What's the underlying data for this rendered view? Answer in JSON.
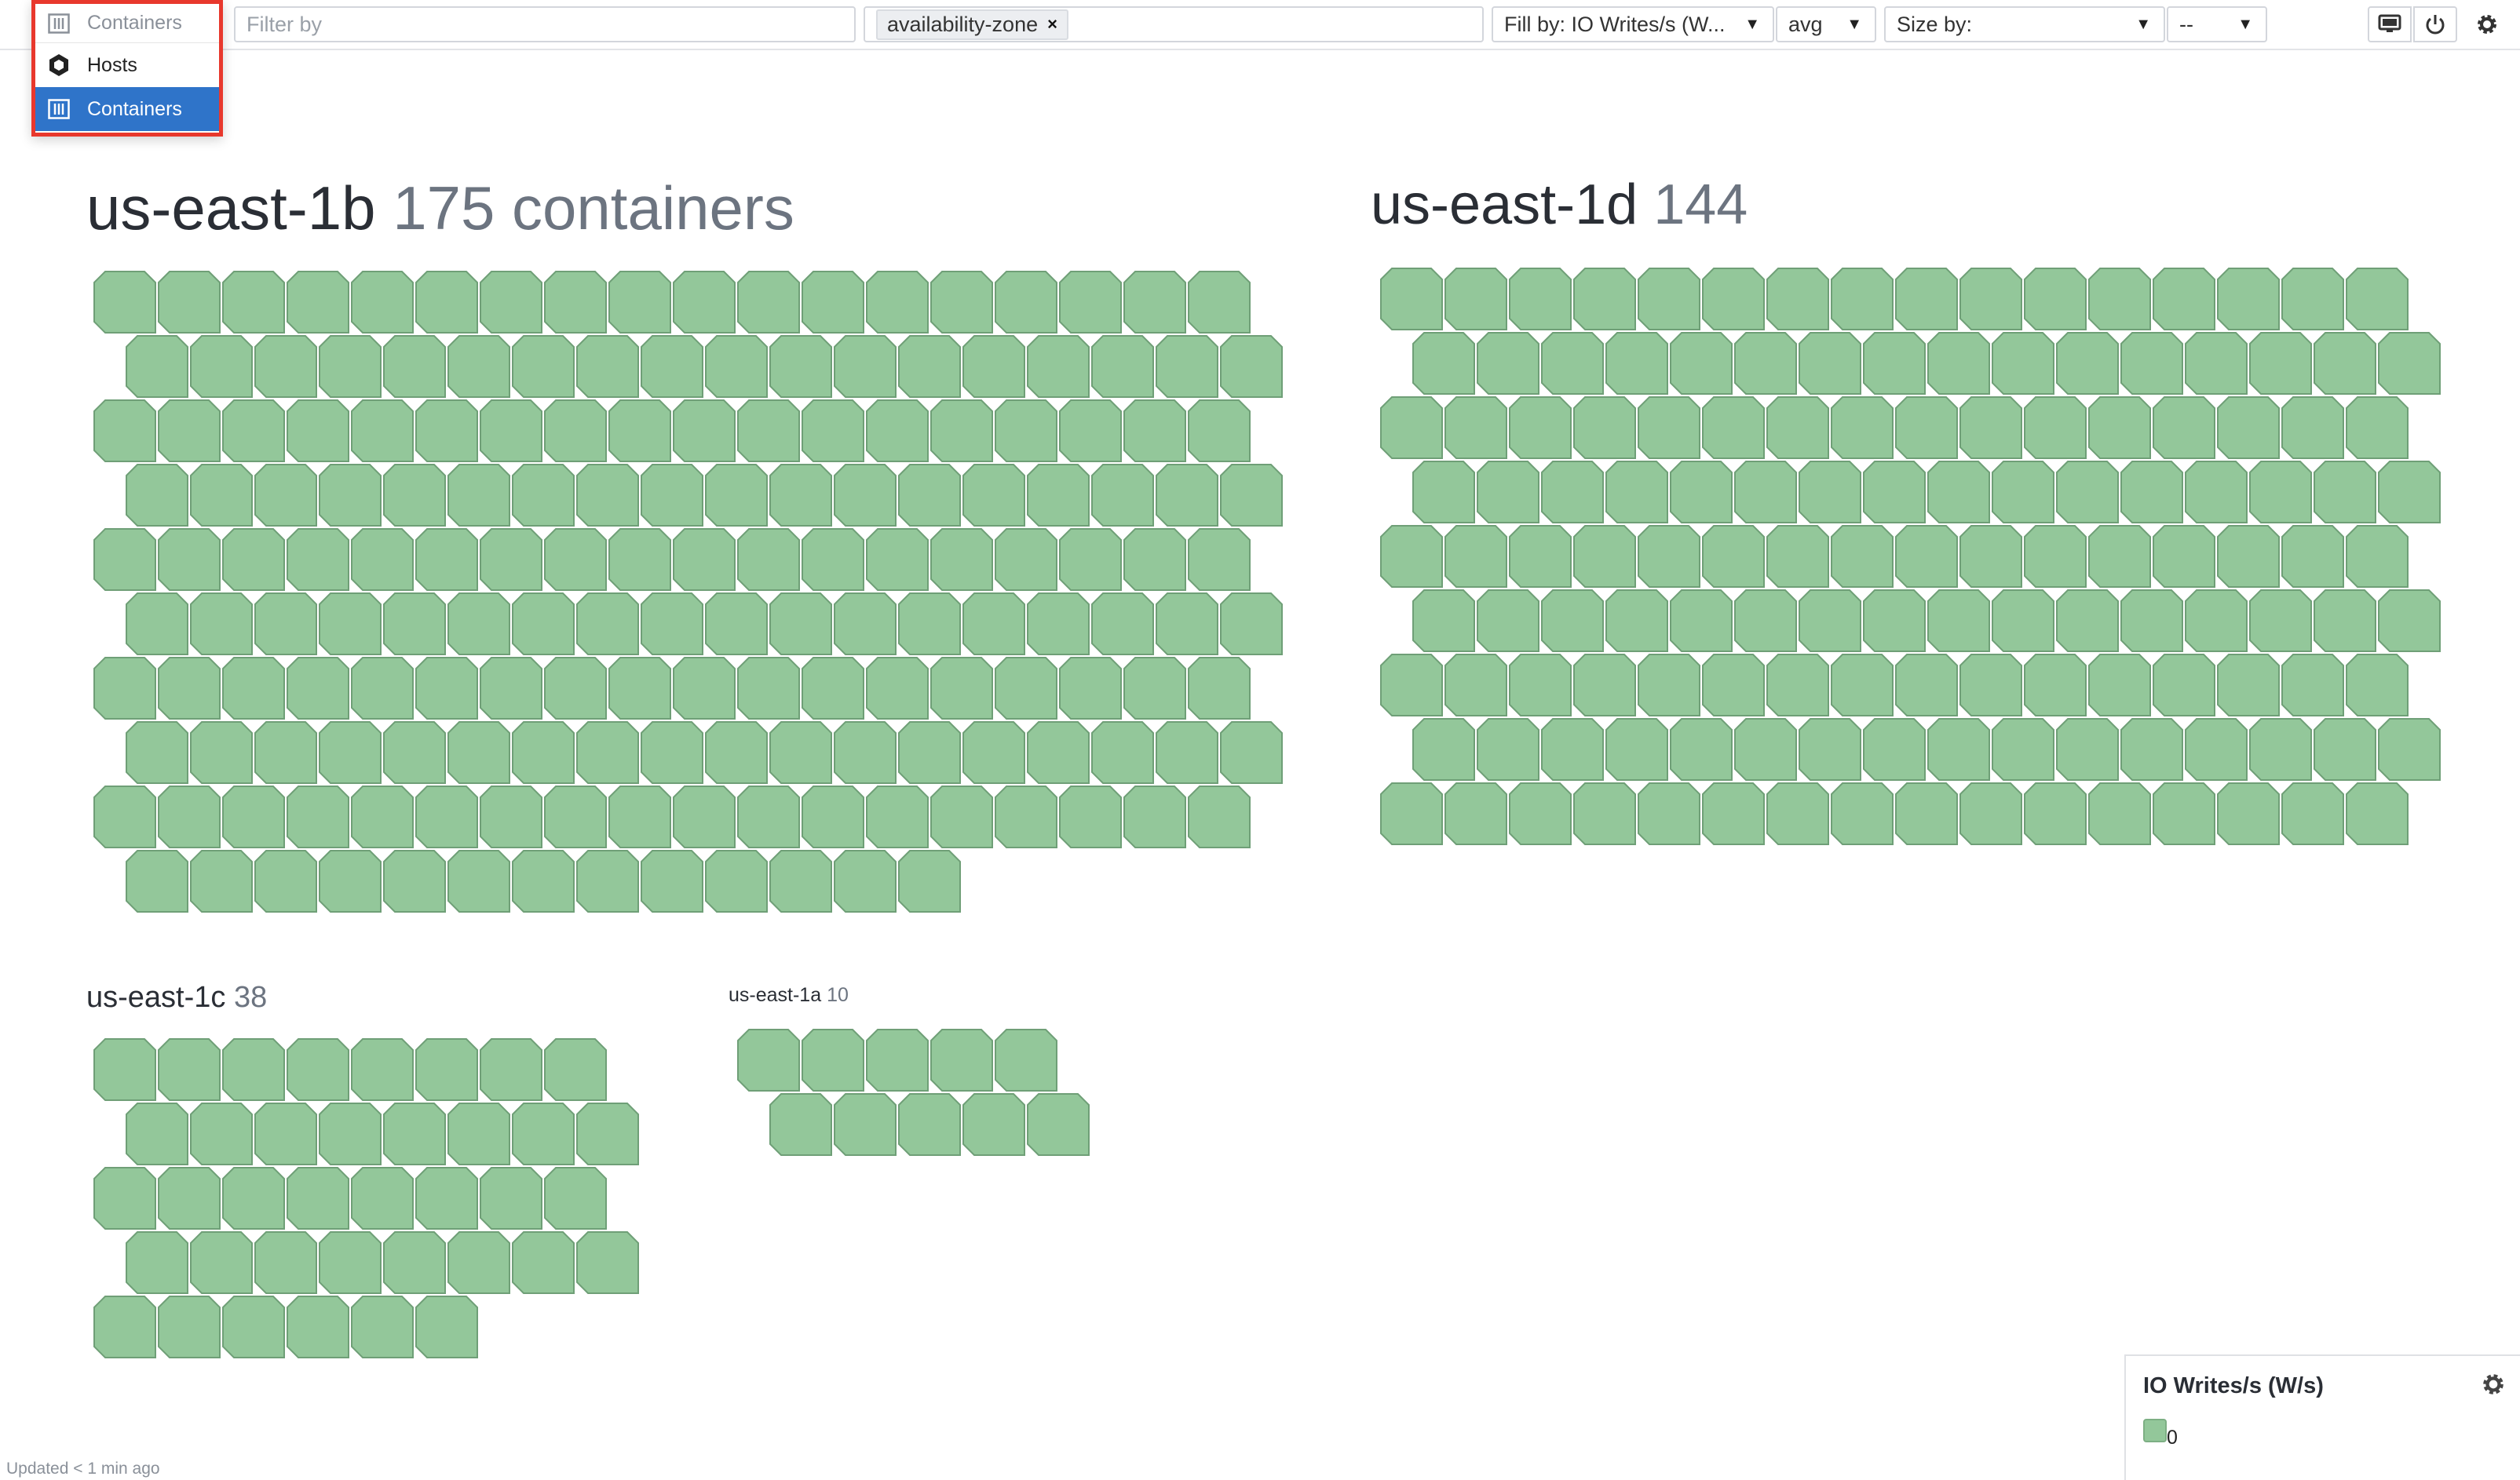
{
  "toolbar": {
    "type_selector_value": "Containers",
    "filter_placeholder": "Filter by",
    "group_tag": "availability-zone",
    "fill_by": "Fill by: IO Writes/s (W...",
    "fill_aggregation": "avg",
    "size_by": "Size by:",
    "size_aggregation": "--"
  },
  "type_dropdown": {
    "current": "Containers",
    "options": [
      {
        "label": "Hosts",
        "icon": "hexagon-icon",
        "selected": false
      },
      {
        "label": "Containers",
        "icon": "container-icon",
        "selected": true
      }
    ]
  },
  "groups": [
    {
      "name": "us-east-1b",
      "count_label": "175 containers",
      "count": 175
    },
    {
      "name": "us-east-1d",
      "count_label": "144",
      "count": 144
    },
    {
      "name": "us-east-1c",
      "count_label": "38",
      "count": 38
    },
    {
      "name": "us-east-1a",
      "count_label": "10",
      "count": 10
    }
  ],
  "legend": {
    "title": "IO Writes/s (W/s)",
    "min_label": "0",
    "fill_color": "#93c79a"
  },
  "footer": {
    "updated": "Updated < 1 min ago"
  }
}
